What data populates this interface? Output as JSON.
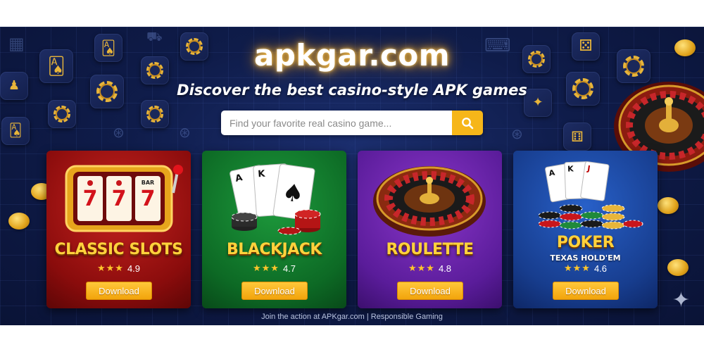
{
  "header": {
    "logo": "apkgar.com",
    "tagline": "Discover the best casino-style APK games"
  },
  "search": {
    "placeholder": "Find your favorite real casino game...",
    "button_icon": "search-icon"
  },
  "cards": [
    {
      "title": "CLASSIC SLOTS",
      "subtitle": "",
      "stars": "★★★",
      "rating": "4.9",
      "button": "Download",
      "theme": "#a51515",
      "art_icon": "slot-machine-icon"
    },
    {
      "title": "BLACKJACK",
      "subtitle": "",
      "stars": "★★★",
      "rating": "4.7",
      "button": "Download",
      "theme": "#12832f",
      "art_icon": "playing-cards-icon"
    },
    {
      "title": "ROULETTE",
      "subtitle": "",
      "stars": "★★★",
      "rating": "4.8",
      "button": "Download",
      "theme": "#6f27b3",
      "art_icon": "roulette-wheel-icon"
    },
    {
      "title": "POKER",
      "subtitle": "TEXAS HOLD'EM",
      "stars": "★★★",
      "rating": "4.6",
      "button": "Download",
      "theme": "#1e4faa",
      "art_icon": "poker-chips-icon"
    }
  ],
  "card_art": {
    "slot_symbols": [
      "7",
      "7",
      "7"
    ],
    "slot_bar": "BAR",
    "card_ranks": [
      "A",
      "K",
      "J"
    ]
  },
  "footer": "Join the action at APKgar.com | Responsible Gaming",
  "colors": {
    "background": "#0f1c4a",
    "accent_gold": "#f6b619",
    "title_gold": "#ffd23c"
  }
}
